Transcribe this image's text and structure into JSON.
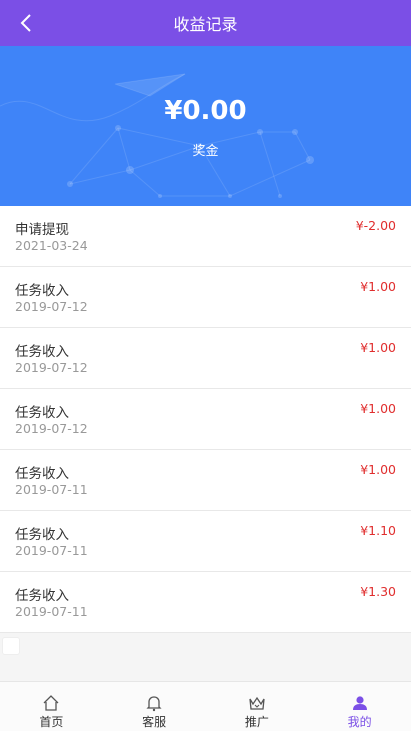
{
  "header": {
    "title": "收益记录",
    "back_icon": "chevron-left-icon"
  },
  "hero": {
    "amount": "¥0.00",
    "label": "奖金"
  },
  "records": [
    {
      "name": "申请提现",
      "date": "2021-03-24",
      "value": "¥-2.00"
    },
    {
      "name": "任务收入",
      "date": "2019-07-12",
      "value": "¥1.00"
    },
    {
      "name": "任务收入",
      "date": "2019-07-12",
      "value": "¥1.00"
    },
    {
      "name": "任务收入",
      "date": "2019-07-12",
      "value": "¥1.00"
    },
    {
      "name": "任务收入",
      "date": "2019-07-11",
      "value": "¥1.00"
    },
    {
      "name": "任务收入",
      "date": "2019-07-11",
      "value": "¥1.10"
    },
    {
      "name": "任务收入",
      "date": "2019-07-11",
      "value": "¥1.30"
    }
  ],
  "tabbar": {
    "items": [
      {
        "label": "首页",
        "icon": "home-icon",
        "active": false
      },
      {
        "label": "客服",
        "icon": "bell-icon",
        "active": false
      },
      {
        "label": "推广",
        "icon": "crown-icon",
        "active": false
      },
      {
        "label": "我的",
        "icon": "user-icon",
        "active": true
      }
    ]
  },
  "colors": {
    "header_bg": "#7b4fe6",
    "hero_bg": "#3f84f8",
    "amount_red": "#e02e2e",
    "active_tab": "#7b4fe6"
  }
}
